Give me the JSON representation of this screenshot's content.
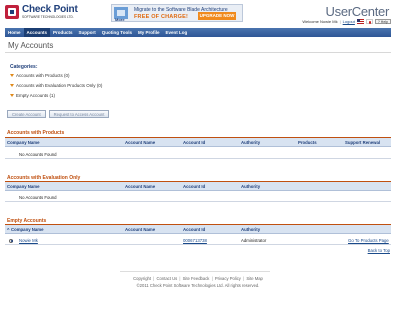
{
  "header": {
    "logo_name": "Check Point",
    "logo_sub": "SOFTWARE TECHNOLOGIES LTD.",
    "banner_line1": "Migrate to the Software Blade Architecture",
    "banner_line2": "FREE OF CHARGE!",
    "banner_button": "UPGRADE NOW",
    "banner_more": "More",
    "app_title": "UserCenter",
    "welcome": "Welcome Nowie Mk",
    "logout": "Logout",
    "help": "Help"
  },
  "nav": {
    "items": [
      {
        "label": "Home"
      },
      {
        "label": "Accounts"
      },
      {
        "label": "Products"
      },
      {
        "label": "Support"
      },
      {
        "label": "Quoting Tools"
      },
      {
        "label": "My Profile"
      },
      {
        "label": "Event Log"
      }
    ],
    "active_index": 1
  },
  "page": {
    "title": "My Accounts",
    "categories_label": "Categories:",
    "categories": [
      {
        "label": "Accounts with Products",
        "count": "(0)"
      },
      {
        "label": "Accounts with Evaluation Products Only",
        "count": "(0)"
      },
      {
        "label": "Empty Accounts",
        "count": "(1)"
      }
    ],
    "buttons": {
      "create": "Create Account",
      "request": "Request to Access Account"
    }
  },
  "sections": {
    "products": {
      "title": "Accounts with Products",
      "columns": [
        "Company Name",
        "Account Name",
        "Account Id",
        "Authority",
        "Products",
        "Support Renewal"
      ],
      "empty_text": "No Accounts Found"
    },
    "evaluation": {
      "title": "Accounts with Evaluation Only",
      "columns": [
        "Company Name",
        "Account Name",
        "Account Id",
        "Authority"
      ],
      "empty_text": "No Accounts Found"
    },
    "empty": {
      "title": "Empty Accounts",
      "columns": [
        "Company Name",
        "Account Name",
        "Account Id",
        "Authority"
      ],
      "rows": [
        {
          "company": "Nowie Mk",
          "account_name": "",
          "account_id": "0006713738",
          "authority": "Administrator",
          "action": "Go To Products Page"
        }
      ]
    }
  },
  "back_to_top": "Back to Top",
  "footer": {
    "links": [
      "Copyright",
      "Contact Us",
      "Site Feedback",
      "Privacy Policy",
      "Site Map"
    ],
    "copyright": "©2011 Check Point Software Technologies Ltd. All rights reserved."
  },
  "colors": {
    "nav_bg": "#2e5696",
    "section_title": "#c05010",
    "table_head": "#d8e3f1",
    "link": "#1a4a8a"
  }
}
